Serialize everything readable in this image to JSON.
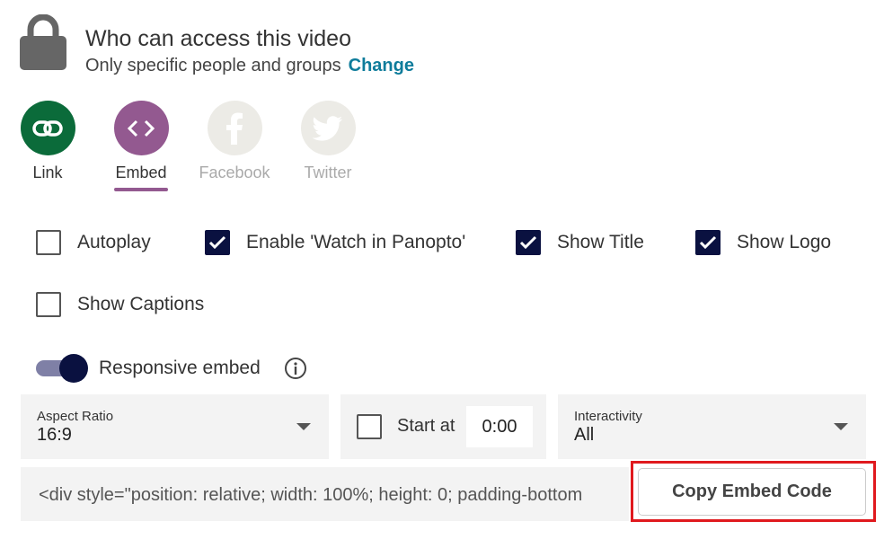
{
  "header": {
    "icon": "lock-icon",
    "title": "Who can access this video",
    "subtitle": "Only specific people and groups",
    "change_link": "Change"
  },
  "share_options": [
    {
      "label": "Link",
      "icon": "link-icon",
      "color": "#0b6b3a",
      "enabled": true
    },
    {
      "label": "Embed",
      "icon": "code-brackets-icon",
      "color": "#935990",
      "enabled": true,
      "selected": true
    },
    {
      "label": "Facebook",
      "icon": "facebook-icon",
      "color": "#ecebe6",
      "enabled": false
    },
    {
      "label": "Twitter",
      "icon": "twitter-icon",
      "color": "#ecebe6",
      "enabled": false
    }
  ],
  "checkboxes": [
    {
      "label": "Autoplay",
      "checked": false
    },
    {
      "label": "Enable 'Watch in Panopto'",
      "checked": true
    },
    {
      "label": "Show Title",
      "checked": true
    },
    {
      "label": "Show Logo",
      "checked": true
    },
    {
      "label": "Show Captions",
      "checked": false
    }
  ],
  "responsive": {
    "label": "Responsive embed",
    "on": true,
    "info_icon": "info-icon"
  },
  "aspect_ratio": {
    "label": "Aspect Ratio",
    "value": "16:9"
  },
  "start_at": {
    "label": "Start at",
    "checked": false,
    "value": "0:00"
  },
  "interactivity": {
    "label": "Interactivity",
    "value": "All"
  },
  "embed_code": "<div style=\"position: relative; width: 100%; height: 0; padding-bottom",
  "copy_button": "Copy Embed Code",
  "colors": {
    "accent": "#0e7c9b",
    "checkbox": "#0a1140",
    "highlight": "#e0191e"
  }
}
